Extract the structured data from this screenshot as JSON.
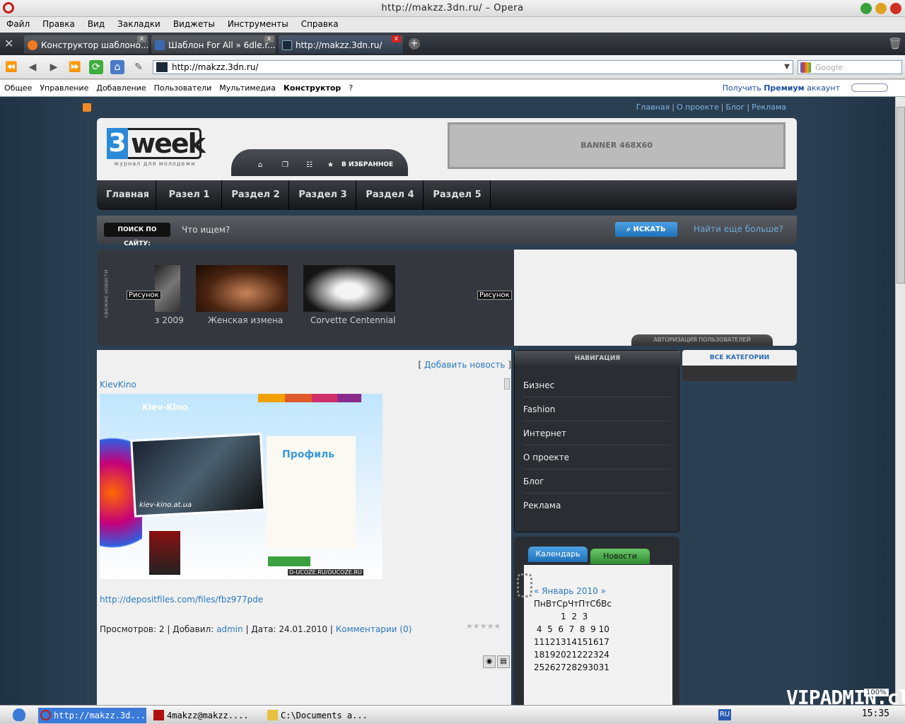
{
  "window": {
    "title": "http://makzz.3dn.ru/ – Opera"
  },
  "menu": [
    "Файл",
    "Правка",
    "Вид",
    "Закладки",
    "Виджеты",
    "Инструменты",
    "Справка"
  ],
  "tabs": [
    {
      "label": "Конструктор шаблоно...",
      "close": "x"
    },
    {
      "label": "Шаблон For All » 6dle.r...",
      "close": "x"
    },
    {
      "label": "http://makzz.3dn.ru/",
      "close": "x"
    }
  ],
  "address": {
    "url": "http://makzz.3dn.ru/",
    "search_placeholder": "Google"
  },
  "ucoz": {
    "items": [
      "Общее",
      "Управление",
      "Добавление",
      "Пользователи",
      "Мультимедиа",
      "Конструктор",
      "?"
    ],
    "premium_pre": "Получить",
    "premium_bold": "Премиум",
    "premium_post": "аккаунт"
  },
  "toplinks": [
    "Главная",
    "О проекте",
    "Блог",
    "Реклама"
  ],
  "header": {
    "logo_num": "3",
    "logo_word": "week",
    "logo_tag": "журнал для молодежи",
    "banner": "BANNER 468X60",
    "favorite": "В ИЗБРАННОЕ"
  },
  "nav": [
    "Главная",
    "Разел 1",
    "Раздел 2",
    "Раздел 3",
    "Раздел 4",
    "Раздел 5"
  ],
  "search": {
    "label": "ПОИСК ПО САЙТУ:",
    "placeholder": "Что ищем?",
    "button": "ИСКАТЬ",
    "more": "Найти еще больше?"
  },
  "fresh": {
    "vertical_label": "свежие новости",
    "items": [
      {
        "caption": "з 2009"
      },
      {
        "caption": "Женская измена"
      },
      {
        "caption": "Corvette Centennial"
      }
    ],
    "risunok": "Рисунок"
  },
  "auth": {
    "tab": "АВТОРИЗАЦИЯ ПОЛЬЗОВАТЕЛЕЙ"
  },
  "post": {
    "add_news": "Добавить новость",
    "title": "KievKino",
    "link": "http://depositfiles.com/files/fbz977pde",
    "views_label": "Просмотров:",
    "views": "2",
    "added_label": "Добавил:",
    "author": "admin",
    "date_label": "Дата:",
    "date": "24.01.2010",
    "comments": "Комментарии (0)",
    "screenshot": {
      "site": "Kiev-Kino",
      "profile": "Профиль",
      "watermark": "kiev-kino.at.ua",
      "credit": "O-UCOZE.RU/OUCOZE.RU"
    }
  },
  "navigation": {
    "title": "НАВИГАЦИЯ",
    "items": [
      "Бизнес",
      "Fashion",
      "Интернет",
      "О проекте",
      "Блог",
      "Реклама"
    ]
  },
  "categories": {
    "title": "ВСЕ КАТЕГОРИИ"
  },
  "calendar": {
    "tab_calendar": "Календарь",
    "tab_news": "Новости",
    "month": "«  Январь 2010  »",
    "header": "ПнВтСрЧтПтСбВс",
    "rows": [
      "          1  2  3",
      " 4  5  6  7  8  9 10",
      "11121314151617",
      "18192021222324",
      "25262728293031"
    ]
  },
  "taskbar": {
    "tasks": [
      "http://makzz.3d...",
      "4makzz@makzz....",
      "C:\\Documents a..."
    ],
    "lang": "RU",
    "clock": "15:35",
    "zoom": "100%"
  },
  "watermark": "VIPADMIN.club",
  "colors": {
    "accent": "#2b7ac0",
    "page_bg": "#2b3f52",
    "opera_red": "#c41a16"
  }
}
